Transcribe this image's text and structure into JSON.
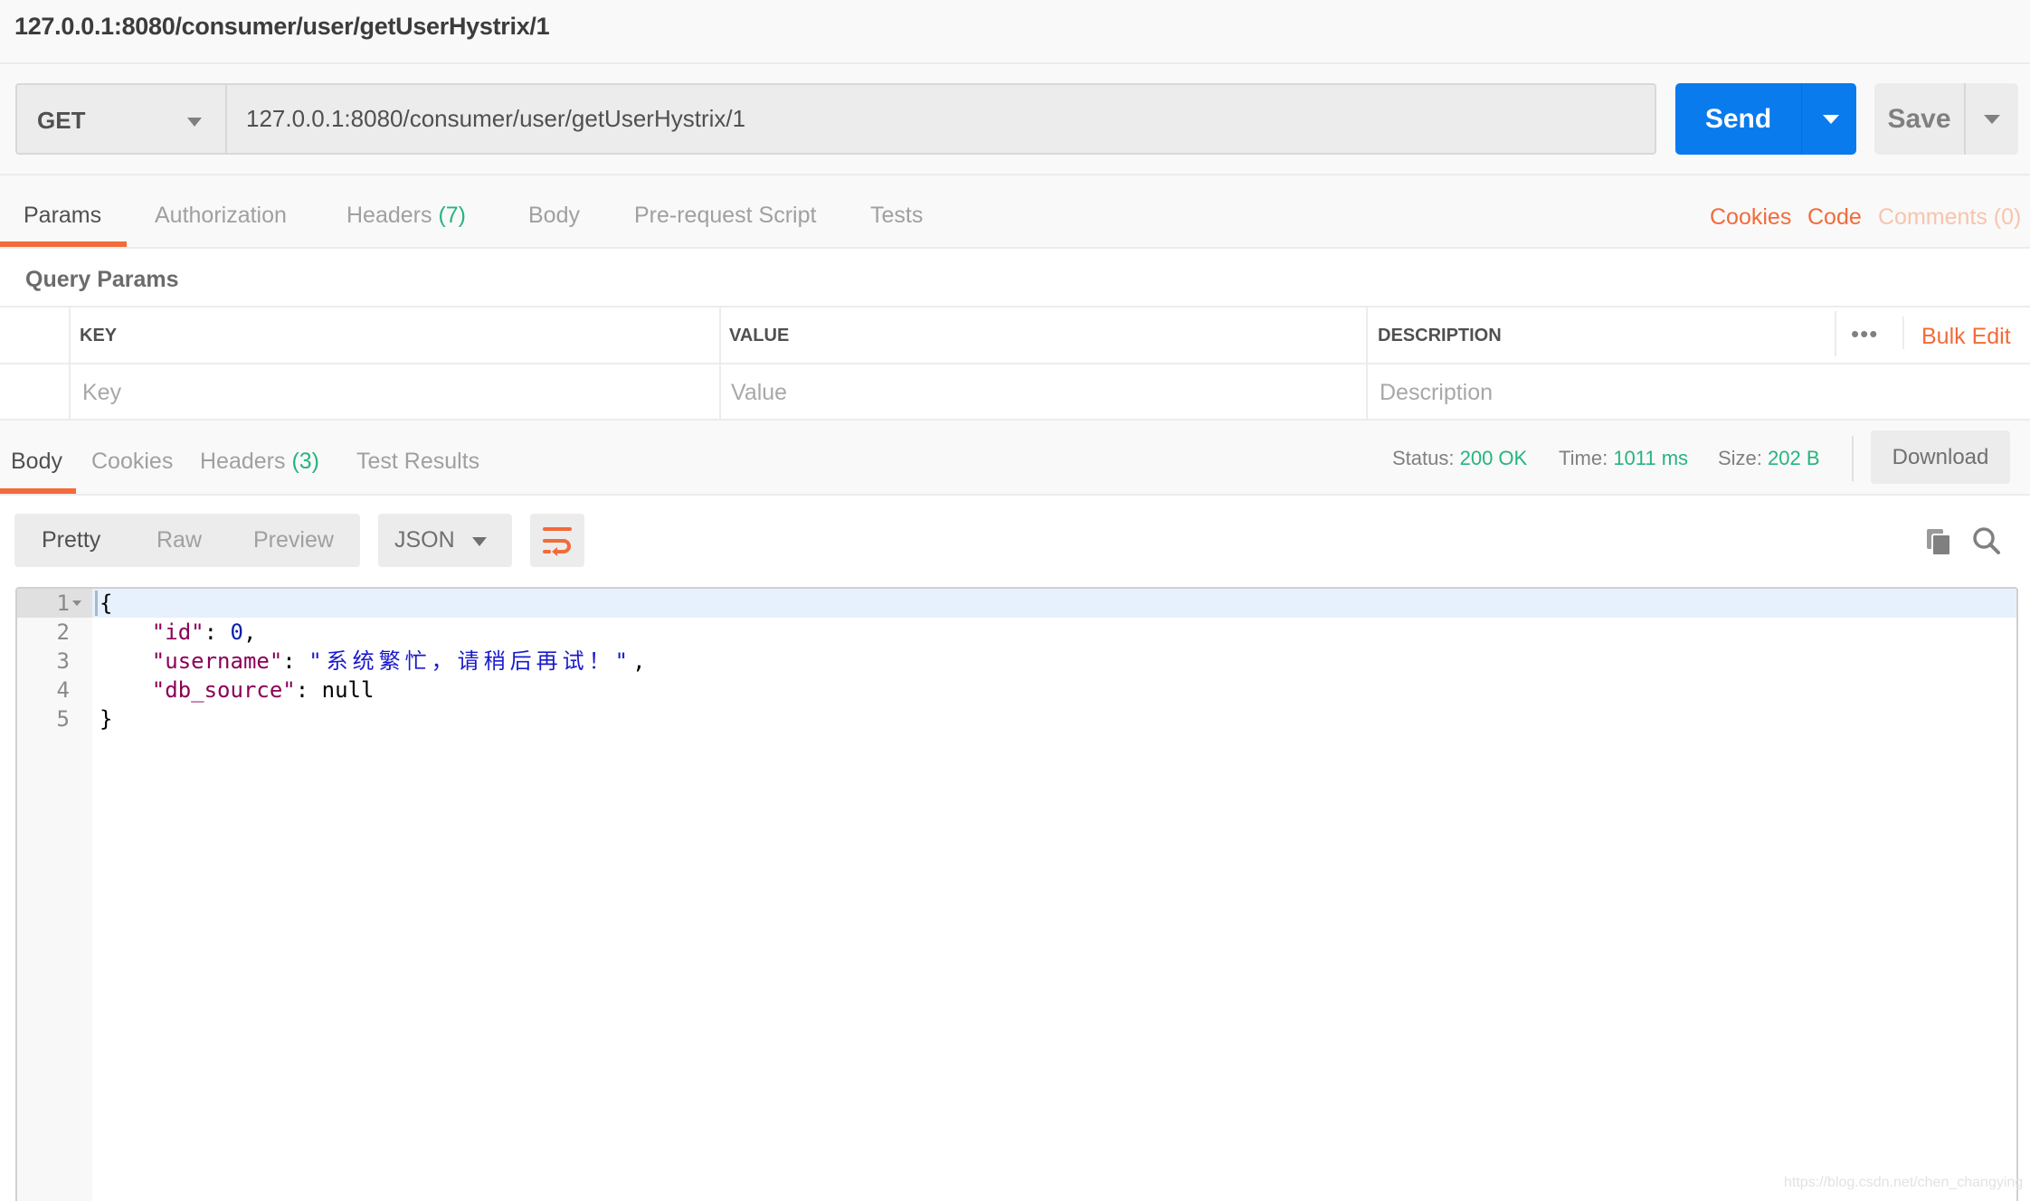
{
  "title_bar": {
    "title": "127.0.0.1:8080/consumer/user/getUserHystrix/1"
  },
  "request": {
    "method": "GET",
    "url": "127.0.0.1:8080/consumer/user/getUserHystrix/1",
    "send_label": "Send",
    "save_label": "Save"
  },
  "request_tabs": {
    "items": [
      {
        "label": "Params",
        "count": "",
        "active": true
      },
      {
        "label": "Authorization",
        "count": ""
      },
      {
        "label": "Headers",
        "count": "(7)"
      },
      {
        "label": "Body",
        "count": ""
      },
      {
        "label": "Pre-request Script",
        "count": ""
      },
      {
        "label": "Tests",
        "count": ""
      }
    ],
    "right_links": {
      "cookies": "Cookies",
      "code": "Code",
      "comments": "Comments (0)"
    }
  },
  "query_params": {
    "title": "Query Params",
    "columns": {
      "key": "KEY",
      "value": "VALUE",
      "description": "DESCRIPTION"
    },
    "placeholders": {
      "key": "Key",
      "value": "Value",
      "description": "Description"
    },
    "more": "•••",
    "bulk_edit": "Bulk Edit"
  },
  "response_tabs": {
    "items": [
      {
        "label": "Body",
        "count": "",
        "active": true
      },
      {
        "label": "Cookies",
        "count": ""
      },
      {
        "label": "Headers",
        "count": "(3)"
      },
      {
        "label": "Test Results",
        "count": ""
      }
    ]
  },
  "response_meta": {
    "status_label": "Status:",
    "status_value": "200 OK",
    "time_label": "Time:",
    "time_value": "1011 ms",
    "size_label": "Size:",
    "size_value": "202 B",
    "download_label": "Download"
  },
  "response_view": {
    "modes": [
      "Pretty",
      "Raw",
      "Preview"
    ],
    "active_mode": "Pretty",
    "format": "JSON",
    "icons": {
      "wrap": "wrap-lines-icon",
      "copy": "copy-icon",
      "search": "search-icon"
    }
  },
  "editor": {
    "line_numbers": [
      "1",
      "2",
      "3",
      "4",
      "5"
    ],
    "lines": {
      "l1": "{",
      "l2_key": "\"id\"",
      "l2_sep": ": ",
      "l2_val": "0",
      "l2_end": ",",
      "l3_key": "\"username\"",
      "l3_sep": ": ",
      "l3_val": "\"系统繁忙，请稍后再试！\"",
      "l3_end": ",",
      "l4_key": "\"db_source\"",
      "l4_sep": ": ",
      "l4_val": "null",
      "l5": "}"
    }
  },
  "colors": {
    "accent_orange": "#f26b3a",
    "send_blue": "#097bed",
    "success_green": "#26b47f"
  },
  "watermark": "https://blog.csdn.net/chen_changying"
}
